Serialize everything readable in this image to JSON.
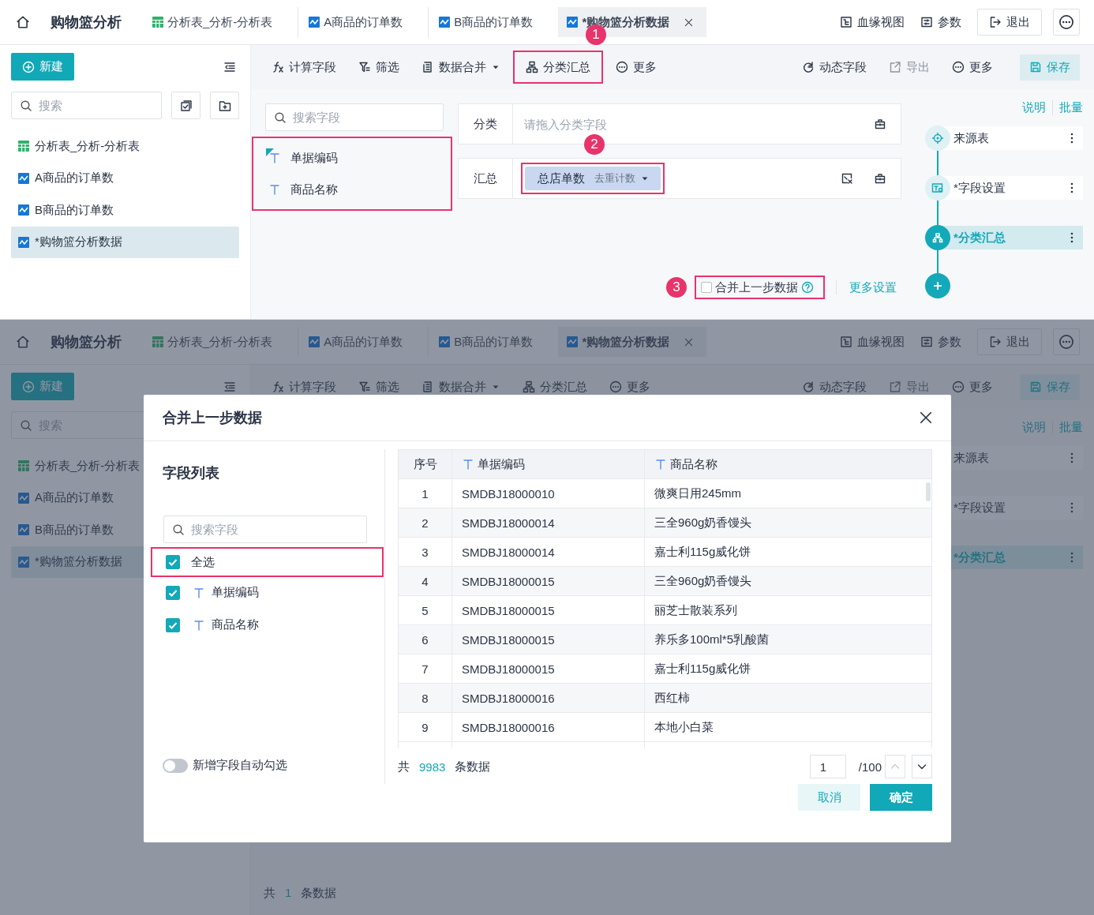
{
  "top_screen": {
    "header": {
      "title": "购物篮分析",
      "tabs": [
        {
          "label": "分析表_分析-分析表",
          "kind": "table",
          "selected": false
        },
        {
          "label": "A商品的订单数",
          "kind": "chart",
          "selected": false
        },
        {
          "label": "B商品的订单数",
          "kind": "chart",
          "selected": false
        },
        {
          "label": "*购物篮分析数据",
          "kind": "chart",
          "selected": true
        }
      ],
      "actions": [
        {
          "label": "血缘视图",
          "kind": "lineage"
        },
        {
          "label": "参数",
          "kind": "params"
        },
        {
          "label": "退出",
          "kind": "exit"
        }
      ]
    },
    "sidebar": {
      "new_button": "新建",
      "search": {
        "placeholder": "搜索"
      },
      "items": [
        {
          "label": "分析表_分析-分析表",
          "kind": "table",
          "selected": false
        },
        {
          "label": "A商品的订单数",
          "kind": "chart",
          "selected": false
        },
        {
          "label": "B商品的订单数",
          "kind": "chart",
          "selected": false
        },
        {
          "label": "*购物篮分析数据",
          "kind": "chart",
          "selected": true
        }
      ]
    },
    "toolbar": {
      "left": [
        {
          "label": "计算字段",
          "kind": "fx",
          "dropdown": false,
          "highlighted": false
        },
        {
          "label": "筛选",
          "kind": "filter",
          "dropdown": false,
          "highlighted": false
        },
        {
          "label": "数据合并",
          "kind": "merge",
          "dropdown": true,
          "highlighted": false
        },
        {
          "label": "分类汇总",
          "kind": "group",
          "dropdown": false,
          "highlighted": true,
          "badge": "1"
        },
        {
          "label": "更多",
          "kind": "more",
          "dropdown": false,
          "highlighted": false
        }
      ],
      "right": [
        {
          "label": "动态字段",
          "kind": "dynamic",
          "disabled": false
        },
        {
          "label": "导出",
          "kind": "export",
          "disabled": true
        },
        {
          "label": "更多",
          "kind": "more",
          "disabled": false
        }
      ],
      "save": "保存"
    },
    "field_list": {
      "search": {
        "placeholder": "搜索字段"
      },
      "highlighted": true,
      "fields": [
        {
          "label": "单据编码",
          "marked": true
        },
        {
          "label": "商品名称",
          "marked": false
        }
      ]
    },
    "config": {
      "category": {
        "label": "分类",
        "placeholder": "请拖入分类字段"
      },
      "summary": {
        "label": "汇总",
        "chip": {
          "name": "总店单数",
          "method": "去重计数",
          "highlighted": true,
          "badge": "2"
        }
      },
      "merge": {
        "label": "合并上一步数据",
        "checked": false,
        "highlighted": true,
        "badge": "3"
      },
      "more_settings": "更多设置"
    },
    "steps": {
      "links": [
        "说明",
        "批量"
      ],
      "items": [
        {
          "label": "来源表",
          "kind": "source",
          "selected": false
        },
        {
          "label": "*字段设置",
          "kind": "fields",
          "selected": false
        },
        {
          "label": "*分类汇总",
          "kind": "group",
          "selected": true
        }
      ]
    }
  },
  "bottom_screen": {
    "header": {
      "title": "购物篮分析",
      "tabs": [
        {
          "label": "分析表_分析-分析表",
          "kind": "table",
          "selected": false
        },
        {
          "label": "A商品的订单数",
          "kind": "chart",
          "selected": false
        },
        {
          "label": "B商品的订单数",
          "kind": "chart",
          "selected": false
        },
        {
          "label": "*购物篮分析数据",
          "kind": "chart",
          "selected": true
        }
      ],
      "actions": [
        {
          "label": "血缘视图",
          "kind": "lineage"
        },
        {
          "label": "参数",
          "kind": "params"
        },
        {
          "label": "退出",
          "kind": "exit"
        }
      ]
    },
    "sidebar": {
      "new_button": "新建",
      "search": {
        "placeholder": "搜索"
      },
      "items": [
        {
          "label": "分析表_分析-分析表",
          "kind": "table",
          "selected": false
        },
        {
          "label": "A商品的订单数",
          "kind": "chart",
          "selected": false
        },
        {
          "label": "B商品的订单数",
          "kind": "chart",
          "selected": false
        },
        {
          "label": "*购物篮分析数据",
          "kind": "chart",
          "selected": true
        }
      ]
    },
    "toolbar": {
      "left": [
        {
          "label": "计算字段",
          "kind": "fx",
          "dropdown": false,
          "highlighted": false
        },
        {
          "label": "筛选",
          "kind": "filter",
          "dropdown": false,
          "highlighted": false
        },
        {
          "label": "数据合并",
          "kind": "merge",
          "dropdown": true,
          "highlighted": false
        },
        {
          "label": "分类汇总",
          "kind": "group",
          "dropdown": false,
          "highlighted": false
        },
        {
          "label": "更多",
          "kind": "more",
          "dropdown": false,
          "highlighted": false
        }
      ],
      "right": [
        {
          "label": "动态字段",
          "kind": "dynamic",
          "disabled": false
        },
        {
          "label": "导出",
          "kind": "export",
          "disabled": true
        },
        {
          "label": "更多",
          "kind": "more",
          "disabled": false
        }
      ],
      "save": "保存"
    },
    "footer": {
      "prefix": "共",
      "count": "1",
      "suffix": "条数据"
    },
    "steps": {
      "links": [
        "说明",
        "批量"
      ],
      "items": [
        {
          "label": "来源表",
          "selected": false
        },
        {
          "label": "*字段设置",
          "selected": false
        },
        {
          "label": "*分类汇总",
          "selected": true
        }
      ]
    },
    "dialog": {
      "title": "合并上一步数据",
      "field_panel": {
        "title": "字段列表",
        "search": {
          "placeholder": "搜索字段"
        },
        "select_all": {
          "label": "全选",
          "checked": true,
          "highlighted": true
        },
        "fields": [
          {
            "label": "单据编码",
            "checked": true
          },
          {
            "label": "商品名称",
            "checked": true
          }
        ],
        "auto_check": {
          "label": "新增字段自动勾选",
          "on": false
        }
      },
      "table": {
        "columns": [
          {
            "label": "序号",
            "kind": "index"
          },
          {
            "label": "单据编码",
            "kind": "text"
          },
          {
            "label": "商品名称",
            "kind": "text"
          }
        ],
        "rows": [
          [
            "1",
            "SMDBJ18000010",
            "微爽日用245mm"
          ],
          [
            "2",
            "SMDBJ18000014",
            "三全960g奶香馒头"
          ],
          [
            "3",
            "SMDBJ18000014",
            "嘉士利115g威化饼"
          ],
          [
            "4",
            "SMDBJ18000015",
            "三全960g奶香馒头"
          ],
          [
            "5",
            "SMDBJ18000015",
            "丽芝士散装系列"
          ],
          [
            "6",
            "SMDBJ18000015",
            "养乐多100ml*5乳酸菌"
          ],
          [
            "7",
            "SMDBJ18000015",
            "嘉士利115g威化饼"
          ],
          [
            "8",
            "SMDBJ18000016",
            "西红柿"
          ],
          [
            "9",
            "SMDBJ18000016",
            "本地小白菜"
          ]
        ]
      },
      "total": {
        "prefix": "共",
        "count": "9983",
        "suffix": "条数据"
      },
      "pager": {
        "page": "1",
        "pages": "/100",
        "prev_disabled": true,
        "next_disabled": false
      },
      "buttons": {
        "cancel": "取消",
        "ok": "确定"
      }
    }
  }
}
